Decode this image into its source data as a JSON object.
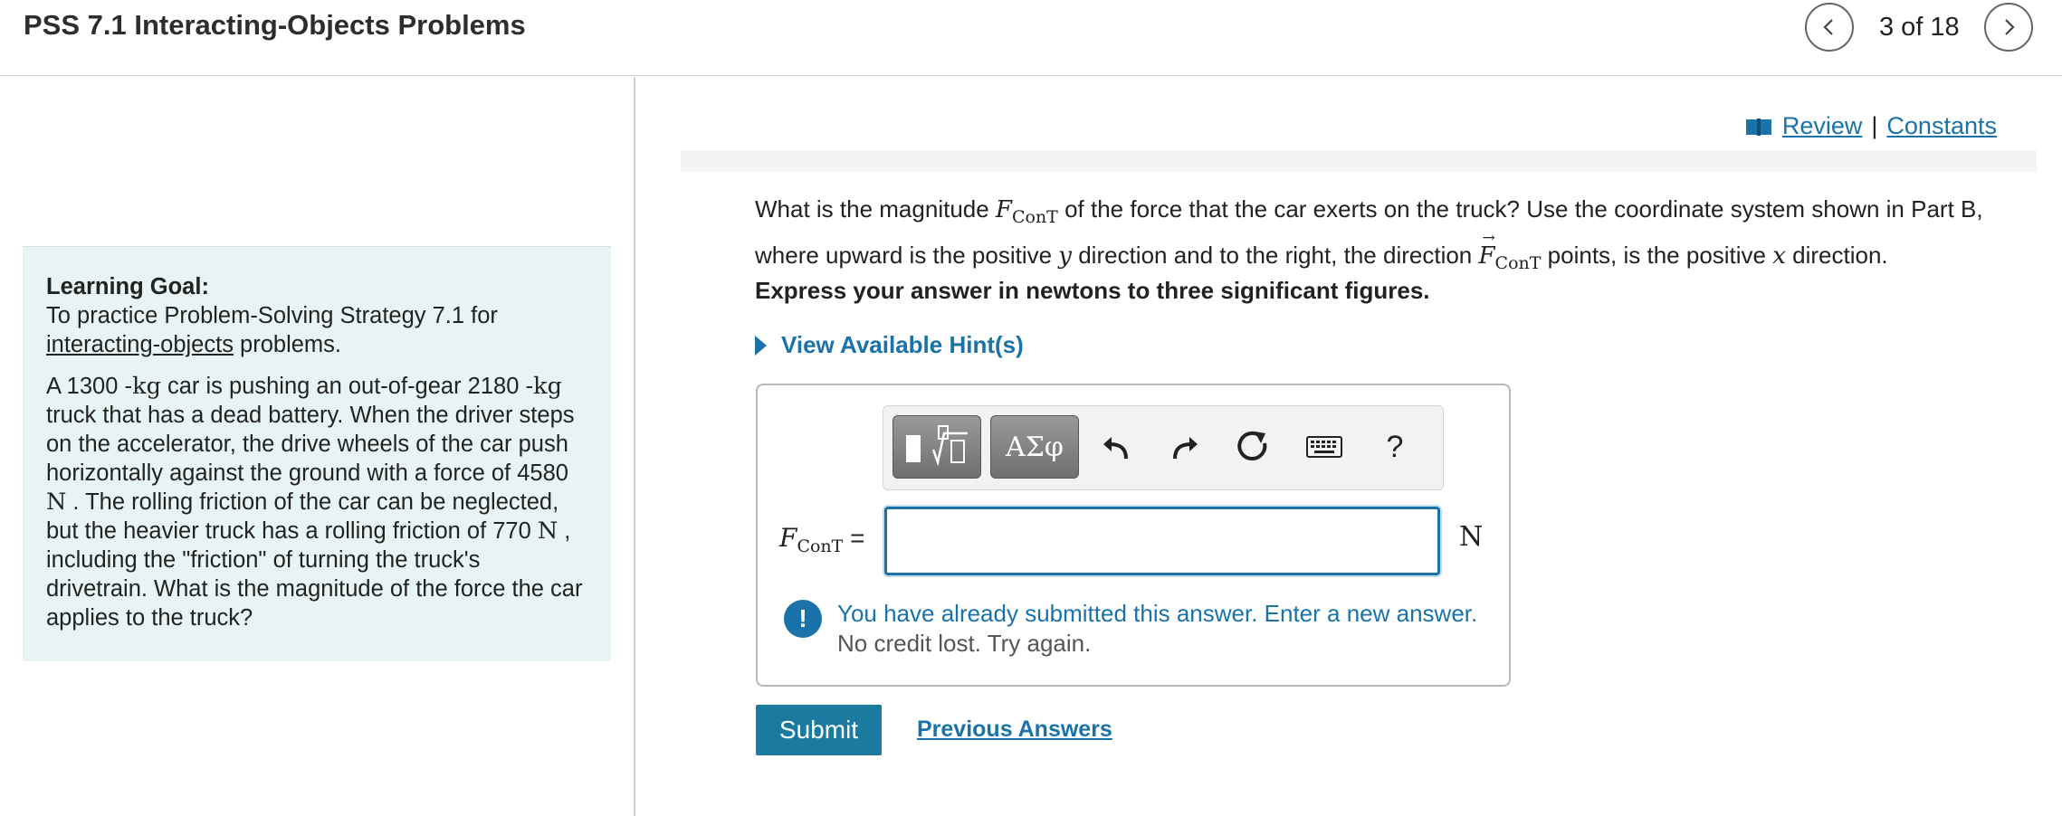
{
  "header": {
    "title": "PSS 7.1 Interacting-Objects Problems",
    "page_counter": "3 of 18",
    "prev_icon": "chevron-left-icon",
    "next_icon": "chevron-right-icon"
  },
  "learning_goal": {
    "heading": "Learning Goal:",
    "intro": "To practice Problem-Solving Strategy 7.1 for",
    "link": "interacting-objects",
    "after_link": " problems.",
    "problem": {
      "p1": "A 1300 ",
      "u1": "-kg",
      "p2": " car is pushing an out-of-gear 2180 ",
      "u2": "-kg",
      "p3": " truck that has a dead battery. When the driver steps on the accelerator, the drive wheels of the car push horizontally against the ground with a force of 4580 ",
      "u3": "N",
      "p4": " . The rolling friction of the car can be neglected, but the heavier truck has a rolling friction of 770 ",
      "u4": "N",
      "p5": " , including the \"friction\" of turning the truck's drivetrain. What is the magnitude of the force the car applies to the truck?"
    }
  },
  "links": {
    "review": " Review",
    "separator": "|",
    "constants": "Constants",
    "icon": "book-icon"
  },
  "question": {
    "t1": "What is the magnitude ",
    "sym": "F",
    "sub": "ConT",
    "t2": " of the force that the car exerts on the truck? Use the coordinate system shown in Part B, where upward is the positive ",
    "y": "y",
    "t3": " direction and to the right, the direction ",
    "t4": " points, is the positive ",
    "x": "x",
    "t5": " direction.",
    "instruction": "Express your answer in newtons to three significant figures.",
    "hint_label": "View Available Hint(s)"
  },
  "toolbar": {
    "symbols_label": "ΑΣφ",
    "help_label": "?",
    "icons": [
      "templates-icon",
      "symbols-icon",
      "undo-icon",
      "redo-icon",
      "reset-icon",
      "keyboard-icon",
      "help-icon"
    ]
  },
  "answer": {
    "label_sym": "F",
    "label_sub": "ConT",
    "equals": " =",
    "value": "",
    "unit": "N"
  },
  "feedback": {
    "icon_glyph": "!",
    "main": "You have already submitted this answer. Enter a new answer.",
    "sub": "No credit lost. Try again."
  },
  "actions": {
    "submit": "Submit",
    "previous_answers": "Previous Answers"
  },
  "colors": {
    "accent": "#1a73a8",
    "goal_background": "#e8f4f4"
  }
}
